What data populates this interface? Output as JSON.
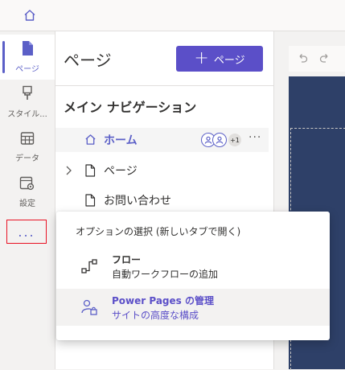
{
  "topbar": {
    "home_icon": "home-icon"
  },
  "rail": {
    "items": [
      {
        "label": "ページ",
        "icon": "page-icon",
        "active": true
      },
      {
        "label": "スタイル...",
        "icon": "paintbrush-icon"
      },
      {
        "label": "データ",
        "icon": "table-icon"
      },
      {
        "label": "設定",
        "icon": "settings-icon"
      }
    ],
    "more_label": "..."
  },
  "panel": {
    "title": "ページ",
    "add_button_label": "ページ",
    "section_title": "メイン ナビゲーション",
    "items": [
      {
        "label": "ホーム",
        "icon": "home-icon",
        "selected": true,
        "avatar_count": "+1",
        "more": "···"
      },
      {
        "label": "ページ",
        "icon": "page-icon",
        "chevron": "chevron-right-icon"
      },
      {
        "label": "お問い合わせ",
        "icon": "page-icon"
      }
    ]
  },
  "flyout": {
    "header": "オプションの選択 (新しいタブで開く)",
    "options": [
      {
        "title": "フロー",
        "subtitle": "自動ワークフローの追加",
        "icon": "flow-icon"
      },
      {
        "title": "Power Pages の管理",
        "subtitle": "サイトの高度な構成",
        "icon": "admin-icon",
        "hover": true
      }
    ]
  },
  "colors": {
    "accent": "#5b5fc7",
    "button_bg": "#5b4fc8",
    "canvas_bg": "#2e4068",
    "highlight_border": "#e81123"
  }
}
